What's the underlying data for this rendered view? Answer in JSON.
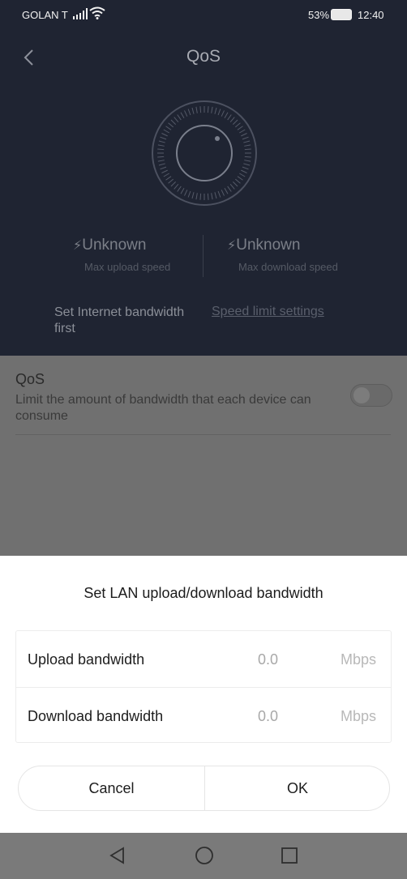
{
  "status_bar": {
    "carrier": "GOLAN T",
    "battery": "53%",
    "time": "12:40"
  },
  "header": {
    "title": "QoS"
  },
  "speeds": {
    "upload_value": "Unknown",
    "upload_label": "Max upload speed",
    "download_value": "Unknown",
    "download_label": "Max download speed"
  },
  "bandwidth_hint": {
    "text": "Set Internet bandwidth first",
    "link": "Speed limit settings"
  },
  "qos_setting": {
    "title": "QoS",
    "description": "Limit the amount of bandwidth that each device can consume",
    "enabled": false
  },
  "dialog": {
    "title": "Set LAN upload/download bandwidth",
    "fields": [
      {
        "label": "Upload bandwidth",
        "value": "0.0",
        "unit": "Mbps"
      },
      {
        "label": "Download bandwidth",
        "value": "0.0",
        "unit": "Mbps"
      }
    ],
    "cancel_label": "Cancel",
    "ok_label": "OK"
  },
  "icons": {
    "back": "chevron-left-icon",
    "nav_back": "triangle-back-icon",
    "nav_home": "circle-home-icon",
    "nav_recent": "square-recent-icon"
  }
}
